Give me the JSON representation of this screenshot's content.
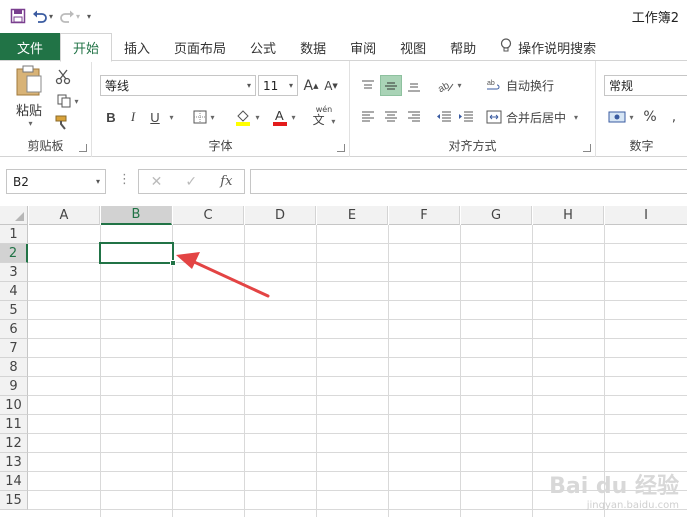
{
  "window": {
    "title": "工作簿2"
  },
  "qat": {
    "save_icon": "save-icon",
    "undo_icon": "undo-icon",
    "redo_icon": "redo-icon",
    "customize_icon": "chevron-down-icon"
  },
  "tabs": [
    {
      "label": "文件"
    },
    {
      "label": "开始"
    },
    {
      "label": "插入"
    },
    {
      "label": "页面布局"
    },
    {
      "label": "公式"
    },
    {
      "label": "数据"
    },
    {
      "label": "审阅"
    },
    {
      "label": "视图"
    },
    {
      "label": "帮助"
    }
  ],
  "tell_me": "操作说明搜索",
  "ribbon": {
    "clipboard": {
      "label": "剪贴板",
      "paste": "粘贴"
    },
    "font": {
      "label": "字体",
      "name": "等线",
      "size": "11",
      "bold": "B",
      "italic": "I",
      "underline": "U",
      "phonetic": "wén"
    },
    "alignment": {
      "label": "对齐方式",
      "wrap": "自动换行",
      "merge": "合并后居中"
    },
    "number": {
      "label": "数字",
      "format": "常规",
      "percent": "%"
    }
  },
  "formula_bar": {
    "name_box": "B2",
    "fx": "fx",
    "value": ""
  },
  "grid": {
    "columns": [
      "A",
      "B",
      "C",
      "D",
      "E",
      "F",
      "G",
      "H",
      "I"
    ],
    "rows": [
      "1",
      "2",
      "3",
      "4",
      "5",
      "6",
      "7",
      "8",
      "9",
      "10",
      "11",
      "12",
      "13",
      "14",
      "15"
    ],
    "selected_cell": "B2"
  },
  "colors": {
    "accent": "#217346",
    "annotation_arrow": "#e34444"
  },
  "watermark": {
    "text": "Bai du 经验",
    "sub": "jingyan.baidu.com"
  }
}
